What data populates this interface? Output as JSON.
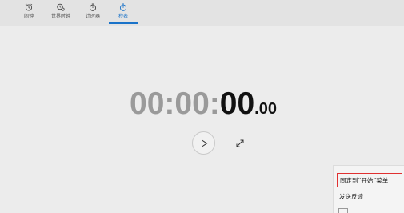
{
  "tabs": [
    {
      "label": "闹钟",
      "icon": "alarm-clock-icon"
    },
    {
      "label": "世界时钟",
      "icon": "world-clock-icon"
    },
    {
      "label": "计时器",
      "icon": "timer-icon"
    },
    {
      "label": "秒表",
      "icon": "stopwatch-icon",
      "active": true
    }
  ],
  "stopwatch": {
    "hours": "00",
    "sep1": ":",
    "minutes": "00",
    "sep2": ":",
    "seconds": "00",
    "centiseconds": ".00"
  },
  "controls": {
    "play_icon": "play-icon",
    "expand_icon": "expand-icon"
  },
  "context_menu": {
    "items": [
      {
        "label": "固定到“开始”菜单",
        "highlighted": true
      },
      {
        "label": "发送反馈"
      }
    ]
  },
  "colors": {
    "accent": "#1a73c9",
    "highlight_border": "#e03131",
    "elapsed_gray": "#9a9a9a"
  }
}
